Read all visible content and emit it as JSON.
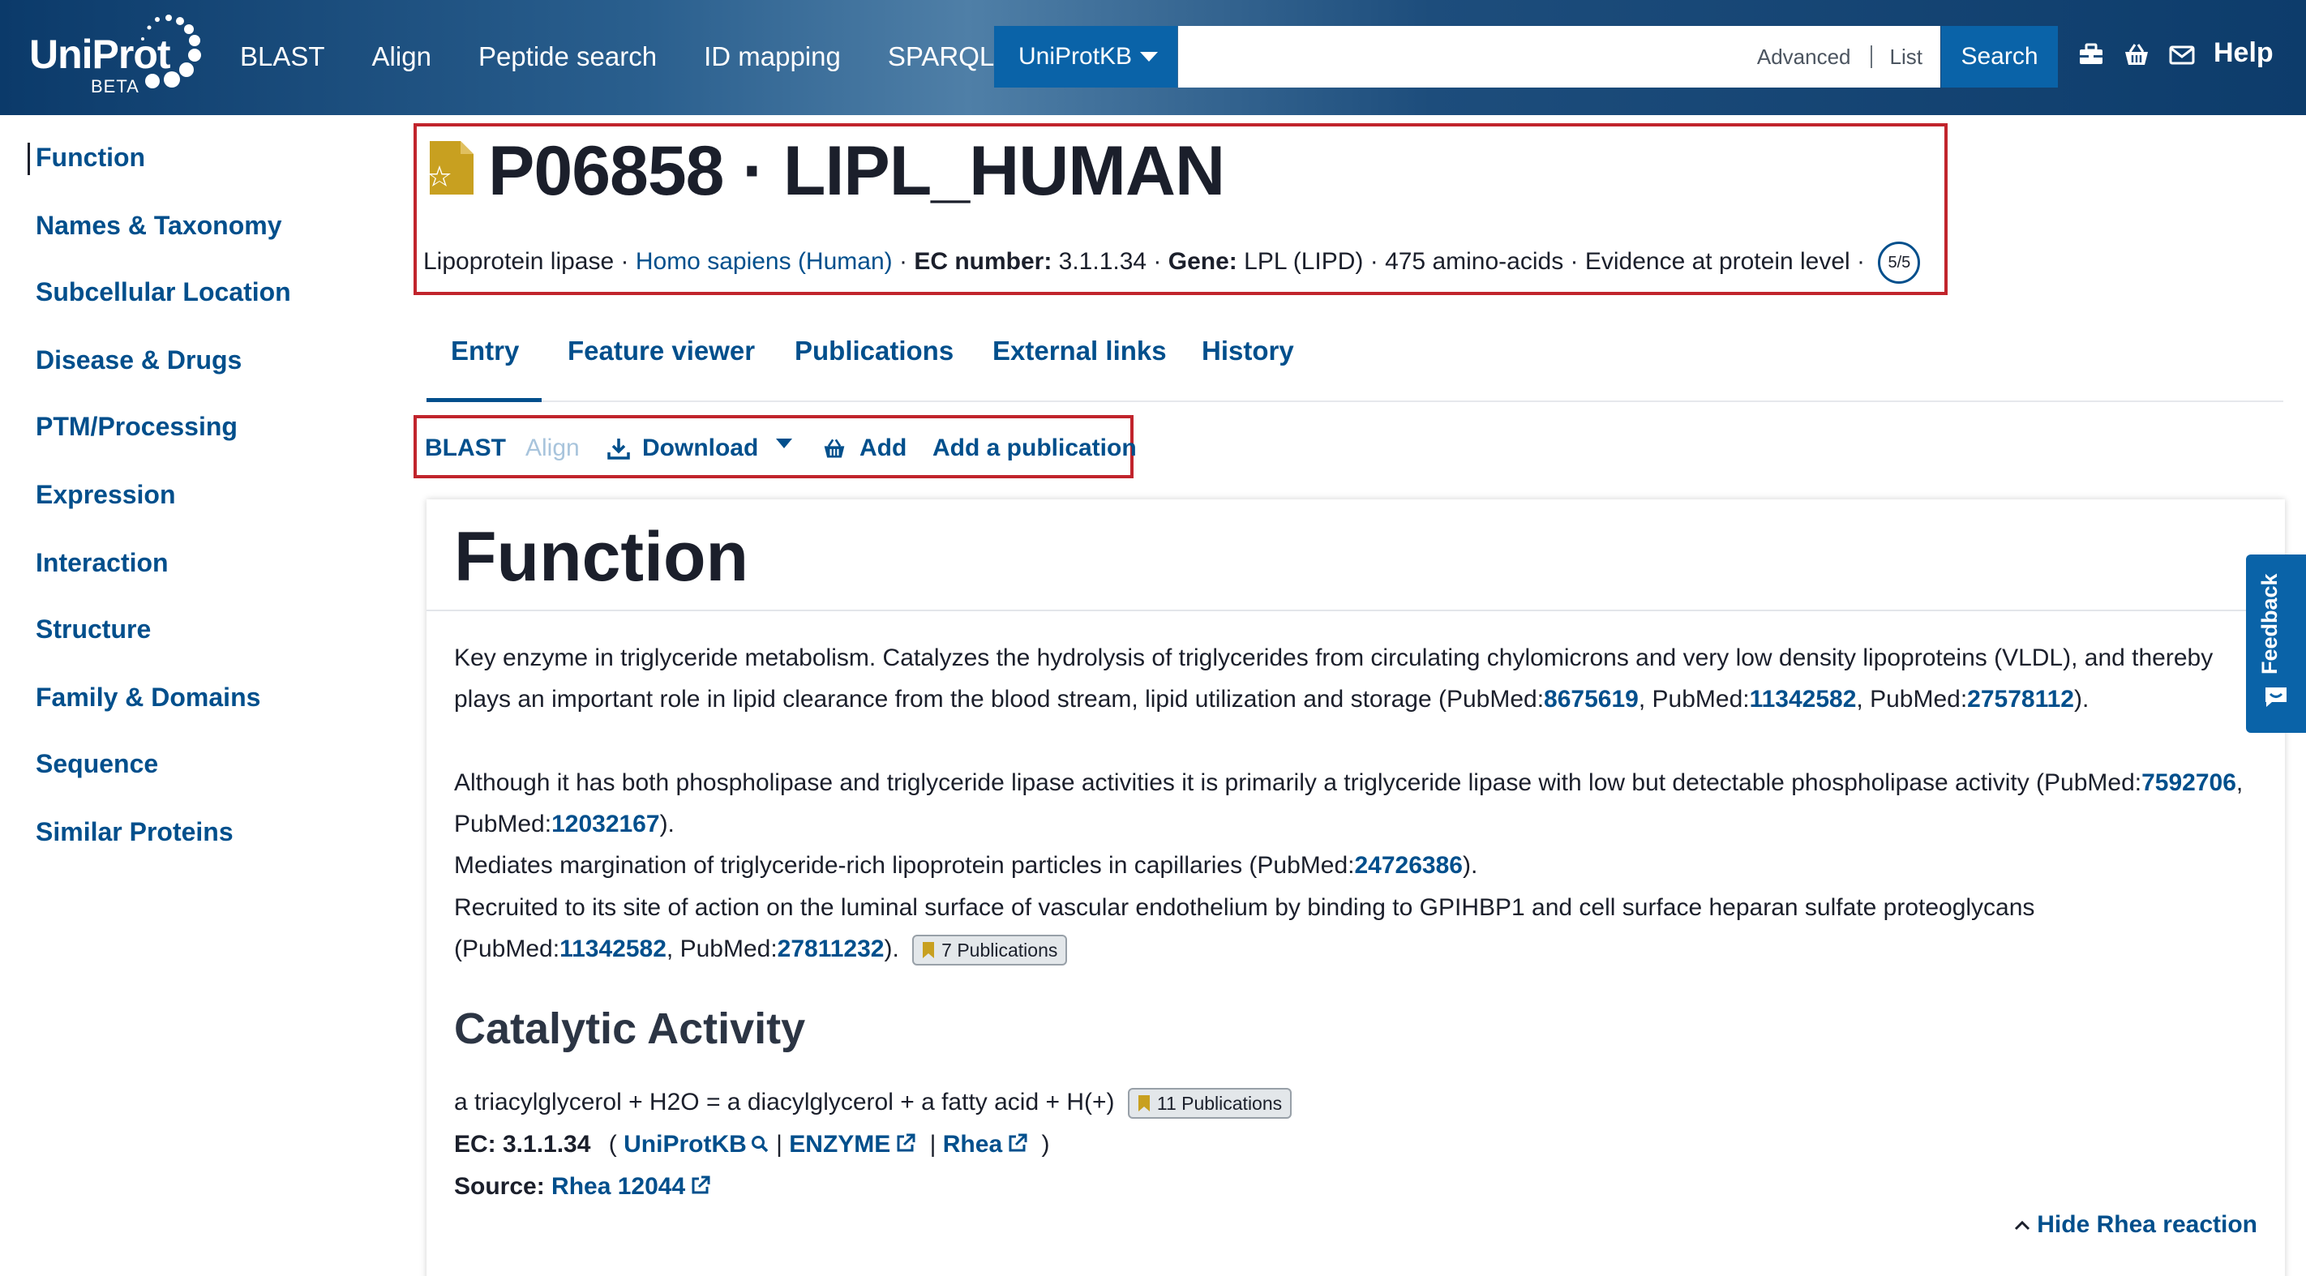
{
  "header": {
    "logo_text": "UniProt",
    "logo_badge": "BETA",
    "nav": [
      "BLAST",
      "Align",
      "Peptide search",
      "ID mapping",
      "SPARQL"
    ],
    "db_select": "UniProtKB",
    "search": {
      "placeholder": "",
      "advanced": "Advanced",
      "list": "List",
      "button": "Search"
    },
    "help": "Help"
  },
  "sidebar": {
    "items": [
      "Function",
      "Names & Taxonomy",
      "Subcellular Location",
      "Disease & Drugs",
      "PTM/Processing",
      "Expression",
      "Interaction",
      "Structure",
      "Family & Domains",
      "Sequence",
      "Similar Proteins"
    ],
    "active": "Function"
  },
  "entry": {
    "title": "P06858 · LIPL_HUMAN",
    "protein": "Lipoprotein lipase ·",
    "organism": "Homo sapiens (Human)",
    "sep1": " · ",
    "ec_label": "EC number:",
    "ec_value": " 3.1.1.34 · ",
    "gene_label": "Gene:",
    "gene_value": " LPL (LIPD) · 475 amino-acids · Evidence at protein level ·",
    "score": "5/5"
  },
  "tabs": [
    "Entry",
    "Feature viewer",
    "Publications",
    "External links",
    "History"
  ],
  "active_tab": "Entry",
  "toolbar": {
    "blast": "BLAST",
    "align": "Align",
    "download": "Download",
    "add": "Add",
    "add_publication": "Add a publication"
  },
  "function": {
    "heading": "Function",
    "p1_a": "Key enzyme in triglyceride metabolism. Catalyzes the hydrolysis of triglycerides from circulating chylomicrons and very low density lipoproteins (VLDL), and thereby plays an important role in lipid clearance from the blood stream, lipid utilization and storage (PubMed:",
    "p1_l1": "8675619",
    "p1_b": ", PubMed:",
    "p1_l2": "11342582",
    "p1_c": ", PubMed:",
    "p1_l3": "27578112",
    "p1_d": ").",
    "p2_a": "Although it has both phospholipase and triglyceride lipase activities it is primarily a triglyceride lipase with low but detectable phospholipase activity (PubMed:",
    "p2_l1": "7592706",
    "p2_b": ", PubMed:",
    "p2_l2": "12032167",
    "p2_c": ").",
    "p3_a": "Mediates margination of triglyceride-rich lipoprotein particles in capillaries (PubMed:",
    "p3_l1": "24726386",
    "p3_b": ").",
    "p4_a": "Recruited to its site of action on the luminal surface of vascular endothelium by binding to GPIHBP1 and cell surface heparan sulfate proteoglycans (PubMed:",
    "p4_l1": "11342582",
    "p4_b": ", PubMed:",
    "p4_l2": "27811232",
    "p4_c": ").",
    "pub_tag": "7 Publications"
  },
  "catalytic": {
    "heading": "Catalytic Activity",
    "reaction": "a triacylglycerol + H2O = a diacylglycerol + a fatty acid + H(+)",
    "pub_tag": "11 Publications",
    "ec_line": "EC: 3.1.1.34",
    "paren_open": "(",
    "uniprotkb": "UniProtKB",
    "pipe1": "|",
    "enzyme": "ENZYME",
    "pipe2": "|",
    "rhea": "Rhea",
    "paren_close": ")",
    "source_label": "Source:",
    "source_link": "Rhea 12044",
    "hide": "Hide Rhea reaction"
  },
  "feedback": "Feedback",
  "colors": {
    "header": "#0b3a6a",
    "accent": "#0a63a8",
    "link": "#014f8c",
    "highlight": "#c1242c",
    "star_badge": "#c8a020"
  }
}
